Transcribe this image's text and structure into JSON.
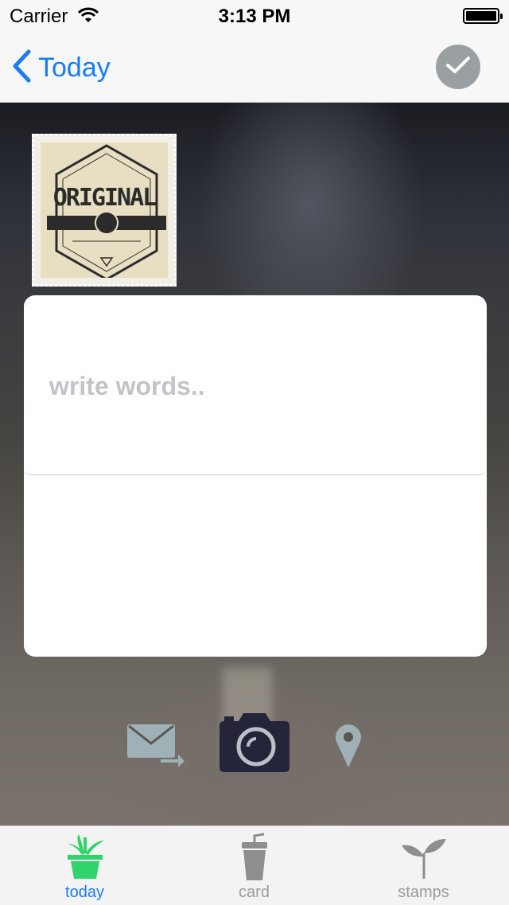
{
  "status_bar": {
    "carrier": "Carrier",
    "time": "3:13 PM"
  },
  "nav": {
    "back_label": "Today",
    "back_icon": "chevron-left-icon",
    "confirm_icon": "checkmark-icon"
  },
  "stamp": {
    "title": "ORIGINAL"
  },
  "editor": {
    "placeholder": "write words..",
    "value": ""
  },
  "actions": [
    {
      "name": "send-mail",
      "icon": "mail-forward-icon",
      "color": "#9fb0b6"
    },
    {
      "name": "camera",
      "icon": "camera-icon",
      "color": "#24253a"
    },
    {
      "name": "location",
      "icon": "location-pin-icon",
      "color": "#9fb0b6"
    }
  ],
  "tabs": [
    {
      "label": "today",
      "icon": "potted-plant-icon",
      "active": true,
      "color": "#2fd46a"
    },
    {
      "label": "card",
      "icon": "cup-icon",
      "active": false
    },
    {
      "label": "stamps",
      "icon": "sprout-icon",
      "active": false
    }
  ],
  "colors": {
    "accent": "#1a7cf5",
    "active_tab_icon": "#2fd46a"
  }
}
